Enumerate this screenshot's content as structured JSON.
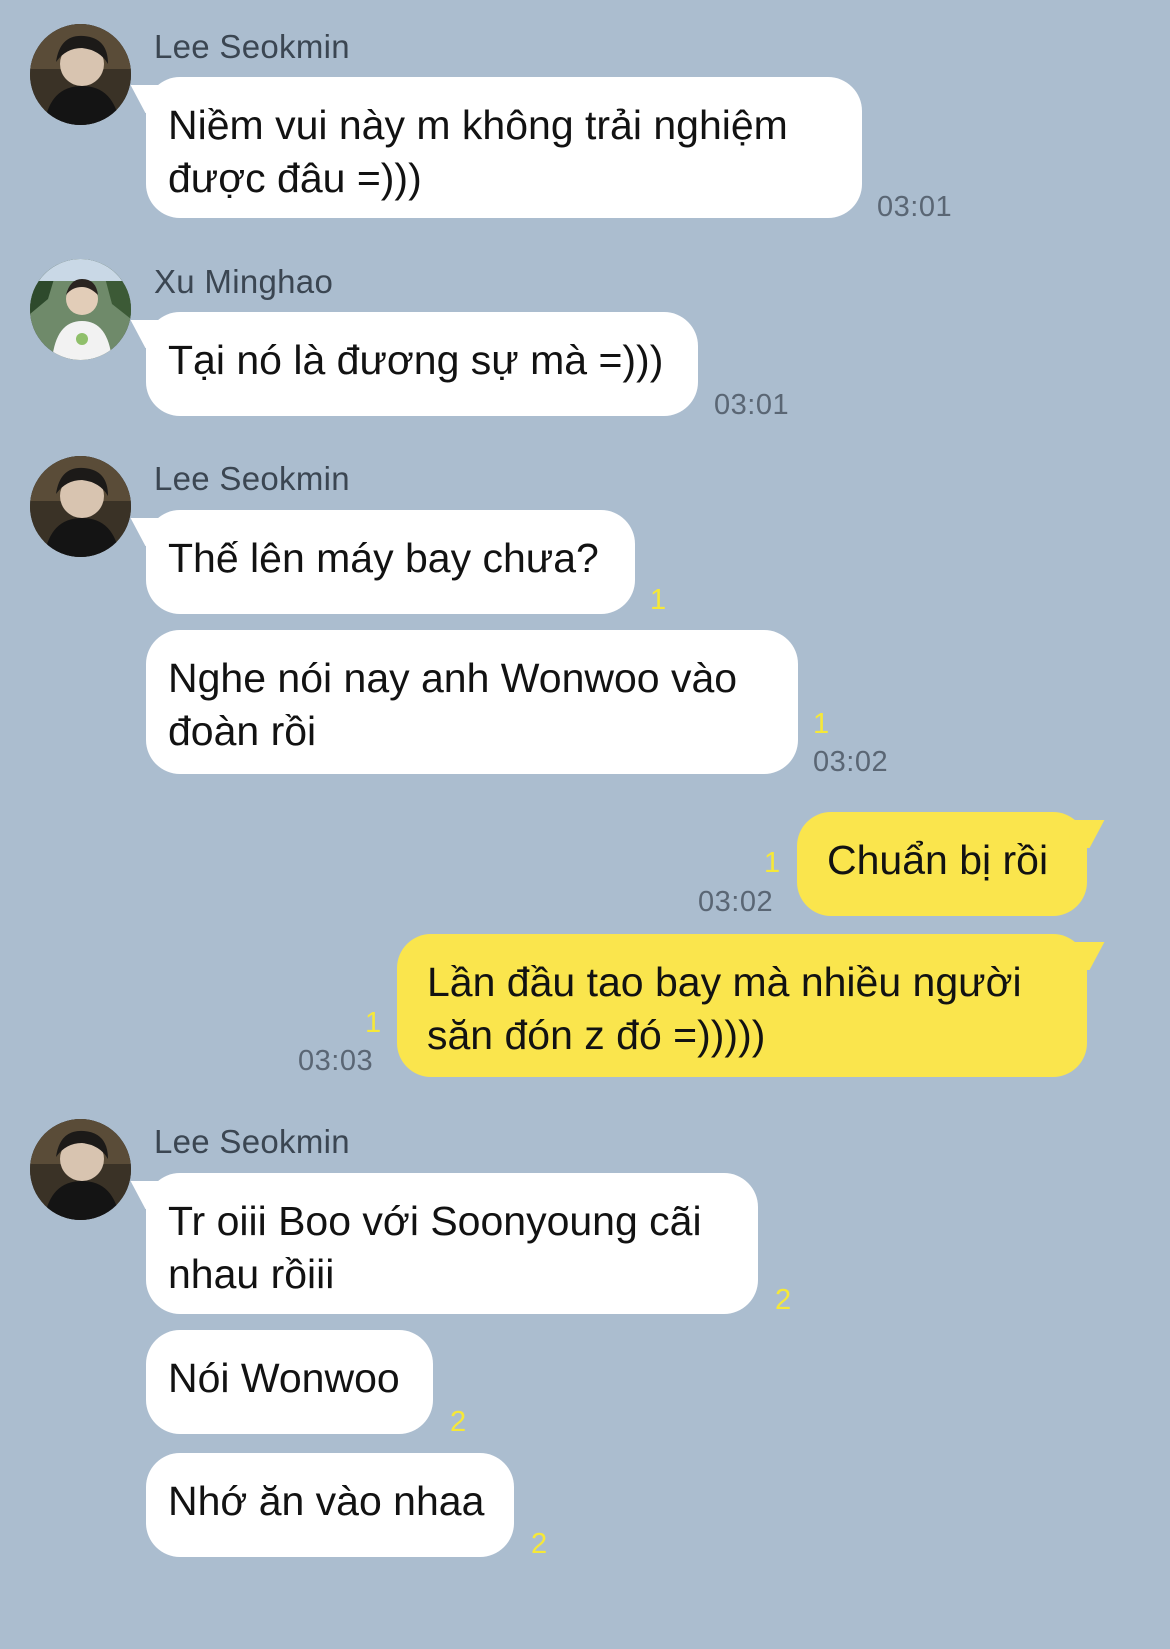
{
  "colors": {
    "background": "#abbdcf",
    "incoming_bubble": "#ffffff",
    "outgoing_bubble": "#fae54d",
    "read_count": "#f6e838",
    "timestamp": "#5a6674"
  },
  "senders": {
    "lee": "Lee Seokmin",
    "xu": "Xu Minghao"
  },
  "messages": [
    {
      "text": "Niềm vui này m không trải nghiệm\nđược đâu =)))",
      "time": "03:01",
      "read": ""
    },
    {
      "text": "Tại nó là đương sự mà =)))",
      "time": "03:01",
      "read": ""
    },
    {
      "text": "Thế lên máy bay chưa?",
      "time": "",
      "read": "1"
    },
    {
      "text": "Nghe nói nay anh Wonwoo vào\nđoàn rồi",
      "time": "03:02",
      "read": "1"
    },
    {
      "text": "Chuẩn bị rồi",
      "time": "03:02",
      "read": "1"
    },
    {
      "text": "Lần đầu tao bay mà nhiều người\nsăn đón z đó =)))))",
      "time": "03:03",
      "read": "1"
    },
    {
      "text": "Tr oiii Boo với Soonyoung cãi\nnhau rồiii",
      "time": "",
      "read": "2"
    },
    {
      "text": "Nói Wonwoo",
      "time": "",
      "read": "2"
    },
    {
      "text": "Nhớ ăn vào nhaa",
      "time": "",
      "read": "2"
    }
  ]
}
